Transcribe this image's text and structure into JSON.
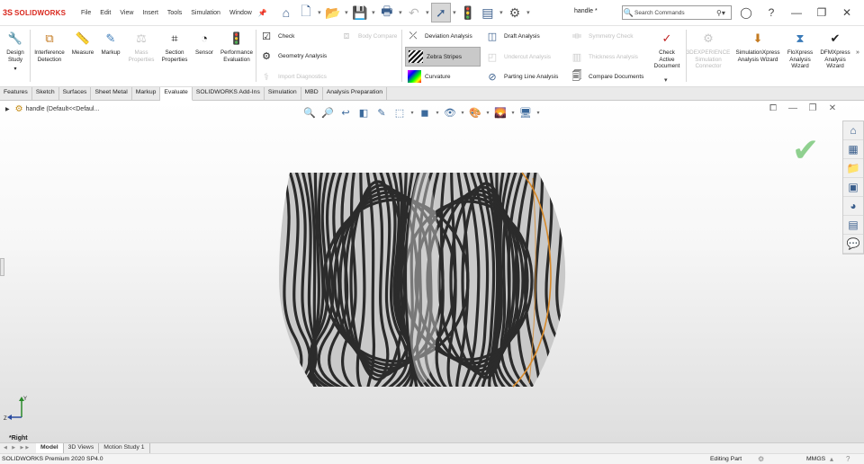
{
  "app": {
    "brand": "SOLIDWORKS",
    "logo_mark": "3S",
    "document_name": "handle *"
  },
  "menu": [
    "File",
    "Edit",
    "View",
    "Insert",
    "Tools",
    "Simulation",
    "Window"
  ],
  "search": {
    "placeholder": "Search Commands"
  },
  "toolbar": {
    "big_tools": [
      {
        "label": "Design\nStudy",
        "icon": "design-study-icon"
      },
      {
        "label": "Interference\nDetection",
        "icon": "interference-icon"
      },
      {
        "label": "Measure",
        "icon": "measure-icon"
      },
      {
        "label": "Markup",
        "icon": "markup-icon"
      },
      {
        "label": "Mass\nProperties",
        "icon": "mass-properties-icon",
        "disabled": true
      },
      {
        "label": "Section\nProperties",
        "icon": "section-properties-icon"
      },
      {
        "label": "Sensor",
        "icon": "sensor-icon"
      },
      {
        "label": "Performance\nEvaluation",
        "icon": "performance-icon"
      }
    ],
    "check_group": [
      {
        "label": "Check",
        "icon": "check-icon"
      },
      {
        "label": "Geometry Analysis",
        "icon": "geometry-analysis-icon"
      },
      {
        "label": "Import Diagnostics",
        "icon": "import-diagnostics-icon",
        "disabled": true
      }
    ],
    "body_compare": {
      "label": "Body Compare",
      "disabled": true
    },
    "analysis_col1": [
      {
        "label": "Deviation Analysis",
        "icon": "deviation-icon"
      },
      {
        "label": "Zebra Stripes",
        "icon": "zebra-icon",
        "active": true
      },
      {
        "label": "Curvature",
        "icon": "curvature-icon"
      }
    ],
    "analysis_col2": [
      {
        "label": "Draft Analysis",
        "icon": "draft-icon"
      },
      {
        "label": "Undercut Analysis",
        "icon": "undercut-icon",
        "disabled": true
      },
      {
        "label": "Parting Line Analysis",
        "icon": "parting-line-icon"
      }
    ],
    "analysis_col3": [
      {
        "label": "Symmetry Check",
        "icon": "symmetry-icon",
        "disabled": true
      },
      {
        "label": "Thickness Analysis",
        "icon": "thickness-icon",
        "disabled": true
      },
      {
        "label": "Compare Documents",
        "icon": "compare-icon"
      }
    ],
    "check_active": {
      "label": "Check\nActive\nDocument"
    },
    "right_tools": [
      {
        "label": "3DEXPERIENCE\nSimulation\nConnector",
        "disabled": true
      },
      {
        "label": "SimulationXpress\nAnalysis Wizard"
      },
      {
        "label": "FloXpress\nAnalysis\nWizard"
      },
      {
        "label": "DFMXpress\nAnalysis\nWizard"
      }
    ]
  },
  "tabs": [
    "Features",
    "Sketch",
    "Surfaces",
    "Sheet Metal",
    "Markup",
    "Evaluate",
    "SOLIDWORKS Add-Ins",
    "Simulation",
    "MBD",
    "Analysis Preparation"
  ],
  "active_tab": "Evaluate",
  "tree": {
    "root": "handle (Default<<Defaul..."
  },
  "view": {
    "orientation": "*Right"
  },
  "bottom_tabs": [
    "Model",
    "3D Views",
    "Motion Study 1"
  ],
  "status": {
    "product": "SOLIDWORKS Premium 2020 SP4.0",
    "mode": "Editing Part",
    "units": "MMGS"
  },
  "colors": {
    "brand": "#d9261c",
    "accent": "#3a5e8c",
    "edge_highlight": "#d88a2a"
  }
}
